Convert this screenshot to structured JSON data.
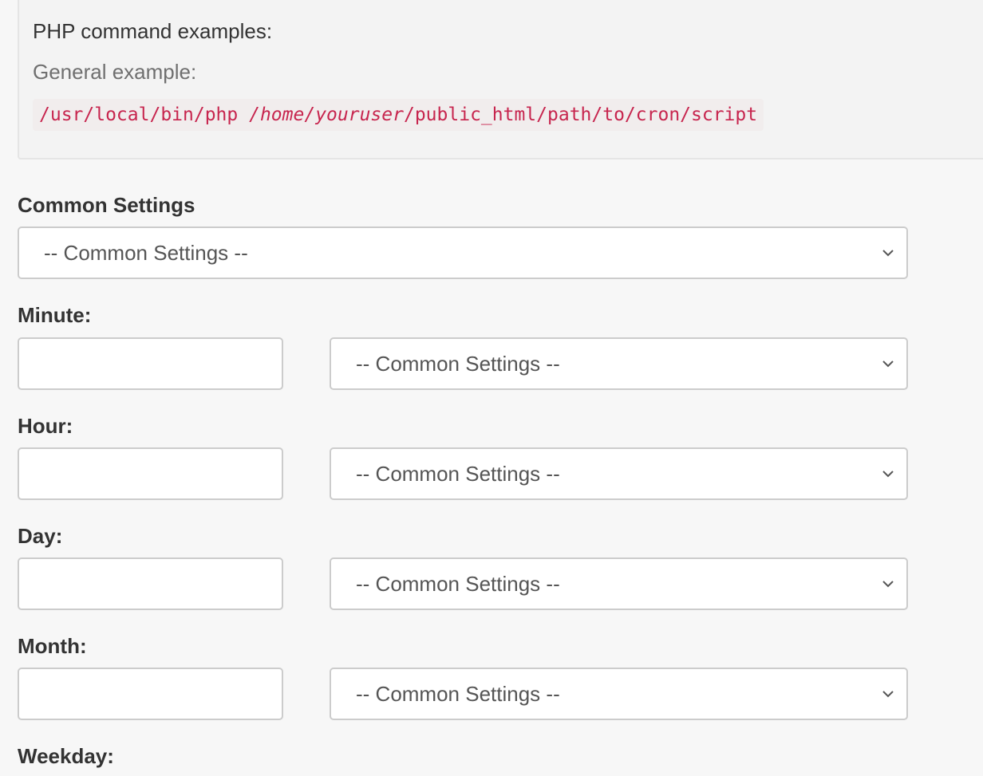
{
  "info": {
    "title": "PHP command examples:",
    "subtitle": "General example:",
    "code_parts": [
      "/usr/local/bin/php ",
      "/home/youruser",
      "/public_html/path/to/cron/script"
    ]
  },
  "form": {
    "common": {
      "label": "Common Settings",
      "select_value": "-- Common Settings --"
    },
    "minute": {
      "label": "Minute:",
      "input_value": "",
      "select_value": "-- Common Settings --"
    },
    "hour": {
      "label": "Hour:",
      "input_value": "",
      "select_value": "-- Common Settings --"
    },
    "day": {
      "label": "Day:",
      "input_value": "",
      "select_value": "-- Common Settings --"
    },
    "month": {
      "label": "Month:",
      "input_value": "",
      "select_value": "-- Common Settings --"
    },
    "weekday": {
      "label": "Weekday:"
    }
  },
  "icons": {
    "select_arrow": "chevron-down-icon"
  },
  "colors": {
    "code_text": "#c7254e",
    "code_bg": "#f1eded",
    "well_bg": "#f3f3f3"
  }
}
